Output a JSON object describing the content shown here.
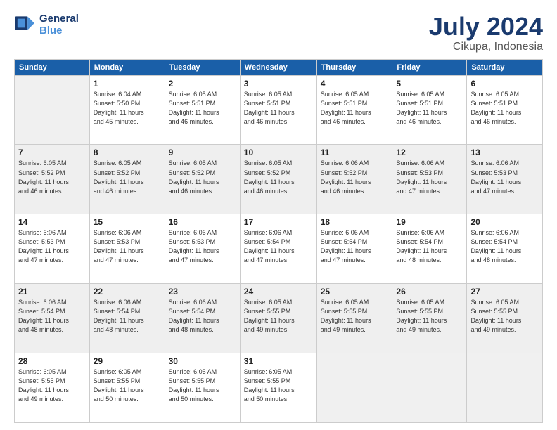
{
  "header": {
    "logo_line1": "General",
    "logo_line2": "Blue",
    "month": "July 2024",
    "location": "Cikupa, Indonesia"
  },
  "weekdays": [
    "Sunday",
    "Monday",
    "Tuesday",
    "Wednesday",
    "Thursday",
    "Friday",
    "Saturday"
  ],
  "weeks": [
    [
      {
        "day": "",
        "info": ""
      },
      {
        "day": "1",
        "info": "Sunrise: 6:04 AM\nSunset: 5:50 PM\nDaylight: 11 hours\nand 45 minutes."
      },
      {
        "day": "2",
        "info": "Sunrise: 6:05 AM\nSunset: 5:51 PM\nDaylight: 11 hours\nand 46 minutes."
      },
      {
        "day": "3",
        "info": "Sunrise: 6:05 AM\nSunset: 5:51 PM\nDaylight: 11 hours\nand 46 minutes."
      },
      {
        "day": "4",
        "info": "Sunrise: 6:05 AM\nSunset: 5:51 PM\nDaylight: 11 hours\nand 46 minutes."
      },
      {
        "day": "5",
        "info": "Sunrise: 6:05 AM\nSunset: 5:51 PM\nDaylight: 11 hours\nand 46 minutes."
      },
      {
        "day": "6",
        "info": "Sunrise: 6:05 AM\nSunset: 5:51 PM\nDaylight: 11 hours\nand 46 minutes."
      }
    ],
    [
      {
        "day": "7",
        "info": "Sunrise: 6:05 AM\nSunset: 5:52 PM\nDaylight: 11 hours\nand 46 minutes."
      },
      {
        "day": "8",
        "info": "Sunrise: 6:05 AM\nSunset: 5:52 PM\nDaylight: 11 hours\nand 46 minutes."
      },
      {
        "day": "9",
        "info": "Sunrise: 6:05 AM\nSunset: 5:52 PM\nDaylight: 11 hours\nand 46 minutes."
      },
      {
        "day": "10",
        "info": "Sunrise: 6:05 AM\nSunset: 5:52 PM\nDaylight: 11 hours\nand 46 minutes."
      },
      {
        "day": "11",
        "info": "Sunrise: 6:06 AM\nSunset: 5:52 PM\nDaylight: 11 hours\nand 46 minutes."
      },
      {
        "day": "12",
        "info": "Sunrise: 6:06 AM\nSunset: 5:53 PM\nDaylight: 11 hours\nand 47 minutes."
      },
      {
        "day": "13",
        "info": "Sunrise: 6:06 AM\nSunset: 5:53 PM\nDaylight: 11 hours\nand 47 minutes."
      }
    ],
    [
      {
        "day": "14",
        "info": "Sunrise: 6:06 AM\nSunset: 5:53 PM\nDaylight: 11 hours\nand 47 minutes."
      },
      {
        "day": "15",
        "info": "Sunrise: 6:06 AM\nSunset: 5:53 PM\nDaylight: 11 hours\nand 47 minutes."
      },
      {
        "day": "16",
        "info": "Sunrise: 6:06 AM\nSunset: 5:53 PM\nDaylight: 11 hours\nand 47 minutes."
      },
      {
        "day": "17",
        "info": "Sunrise: 6:06 AM\nSunset: 5:54 PM\nDaylight: 11 hours\nand 47 minutes."
      },
      {
        "day": "18",
        "info": "Sunrise: 6:06 AM\nSunset: 5:54 PM\nDaylight: 11 hours\nand 47 minutes."
      },
      {
        "day": "19",
        "info": "Sunrise: 6:06 AM\nSunset: 5:54 PM\nDaylight: 11 hours\nand 48 minutes."
      },
      {
        "day": "20",
        "info": "Sunrise: 6:06 AM\nSunset: 5:54 PM\nDaylight: 11 hours\nand 48 minutes."
      }
    ],
    [
      {
        "day": "21",
        "info": "Sunrise: 6:06 AM\nSunset: 5:54 PM\nDaylight: 11 hours\nand 48 minutes."
      },
      {
        "day": "22",
        "info": "Sunrise: 6:06 AM\nSunset: 5:54 PM\nDaylight: 11 hours\nand 48 minutes."
      },
      {
        "day": "23",
        "info": "Sunrise: 6:06 AM\nSunset: 5:54 PM\nDaylight: 11 hours\nand 48 minutes."
      },
      {
        "day": "24",
        "info": "Sunrise: 6:05 AM\nSunset: 5:55 PM\nDaylight: 11 hours\nand 49 minutes."
      },
      {
        "day": "25",
        "info": "Sunrise: 6:05 AM\nSunset: 5:55 PM\nDaylight: 11 hours\nand 49 minutes."
      },
      {
        "day": "26",
        "info": "Sunrise: 6:05 AM\nSunset: 5:55 PM\nDaylight: 11 hours\nand 49 minutes."
      },
      {
        "day": "27",
        "info": "Sunrise: 6:05 AM\nSunset: 5:55 PM\nDaylight: 11 hours\nand 49 minutes."
      }
    ],
    [
      {
        "day": "28",
        "info": "Sunrise: 6:05 AM\nSunset: 5:55 PM\nDaylight: 11 hours\nand 49 minutes."
      },
      {
        "day": "29",
        "info": "Sunrise: 6:05 AM\nSunset: 5:55 PM\nDaylight: 11 hours\nand 50 minutes."
      },
      {
        "day": "30",
        "info": "Sunrise: 6:05 AM\nSunset: 5:55 PM\nDaylight: 11 hours\nand 50 minutes."
      },
      {
        "day": "31",
        "info": "Sunrise: 6:05 AM\nSunset: 5:55 PM\nDaylight: 11 hours\nand 50 minutes."
      },
      {
        "day": "",
        "info": ""
      },
      {
        "day": "",
        "info": ""
      },
      {
        "day": "",
        "info": ""
      }
    ]
  ]
}
